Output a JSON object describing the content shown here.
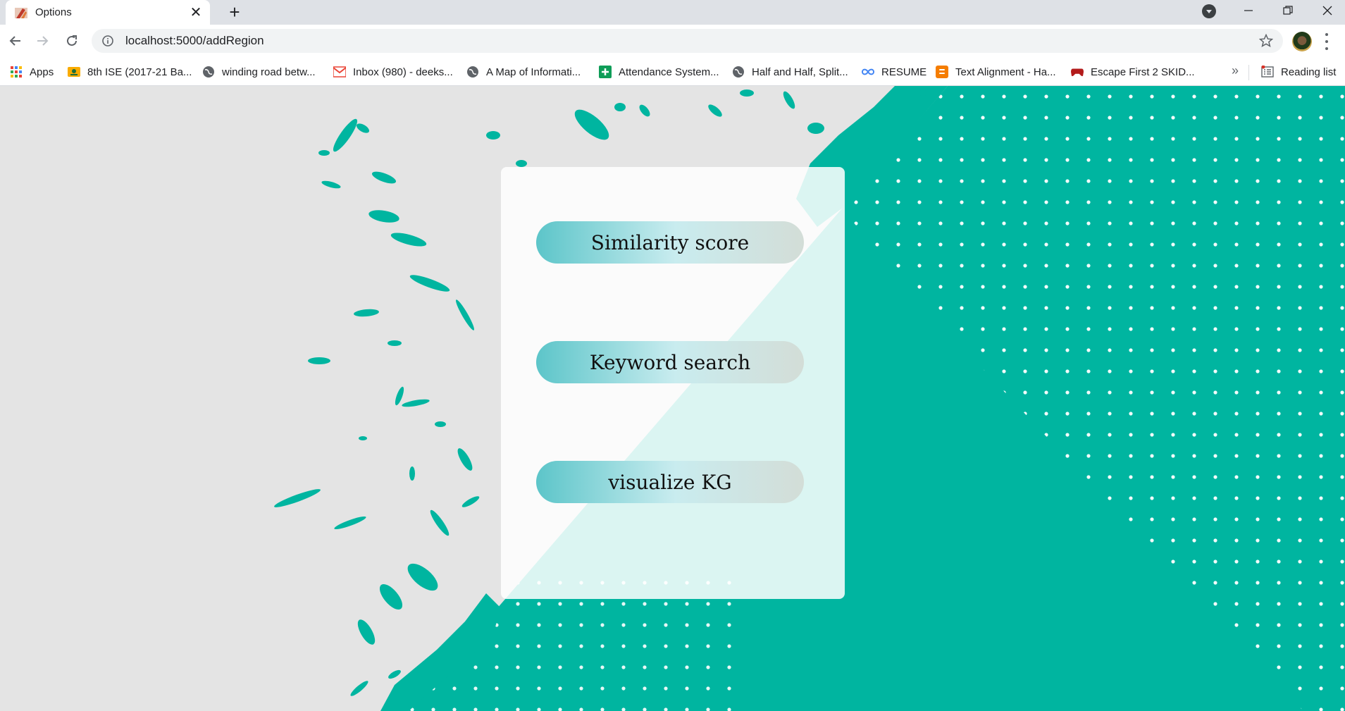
{
  "browser": {
    "tab": {
      "title": "Options"
    },
    "address": {
      "host": "localhost",
      "path": ":5000/addRegion",
      "full": "localhost:5000/addRegion"
    },
    "bookmarks": [
      {
        "label": "Apps",
        "icon": "apps-grid-icon"
      },
      {
        "label": "8th ISE (2017-21 Ba...",
        "icon": "classroom-icon"
      },
      {
        "label": "winding road betw...",
        "icon": "globe-icon"
      },
      {
        "label": "Inbox (980) - deeks...",
        "icon": "gmail-icon"
      },
      {
        "label": "A Map of Informati...",
        "icon": "globe-icon"
      },
      {
        "label": "Attendance System...",
        "icon": "sheets-plus-icon"
      },
      {
        "label": "Half and Half, Split...",
        "icon": "globe-icon"
      },
      {
        "label": "RESUME",
        "icon": "infinity-icon"
      },
      {
        "label": "Text Alignment - Ha...",
        "icon": "blogger-icon"
      },
      {
        "label": "Escape First 2 SKID...",
        "icon": "gamepad-icon"
      }
    ],
    "reading_list": {
      "label": "Reading list",
      "icon": "reading-list-icon"
    }
  },
  "colors": {
    "accent": "#00b5a0",
    "tabstrip": "#dee1e6",
    "page_background": "#e4e4e4"
  },
  "options": {
    "similarity": "Similarity score",
    "keyword": "Keyword search",
    "visualize": "visualize KG"
  }
}
